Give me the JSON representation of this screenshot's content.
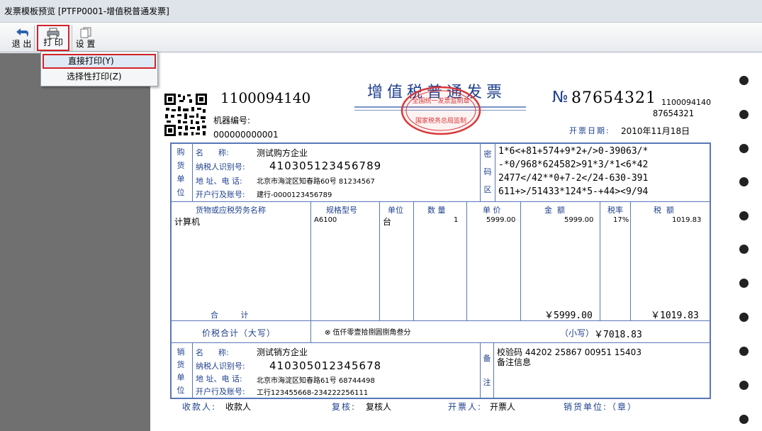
{
  "window": {
    "title": "发票模板预览 [PTFP0001-增值税普通发票]"
  },
  "toolbar": {
    "exit": "退 出",
    "print": "打 印",
    "settings": "设 置"
  },
  "menu": {
    "direct": "直接打印(Y)",
    "select": "选择性打印(Z)"
  },
  "invoice": {
    "title": "增值税普通发票",
    "code": "1100094140",
    "machine_label": "机器编号:",
    "machine_no": "000000000001",
    "no_prefix": "№",
    "number": "87654321",
    "code_small": "1100094140",
    "number_small": "87654321",
    "date_label": "开票日期:",
    "date": "2010年11月18日",
    "stamp_top": "全国统一发票监制章",
    "stamp_bottom": "国家税务总局监制",
    "buyer": {
      "side": [
        "购",
        "货",
        "单",
        "位"
      ],
      "name_label": "名      称:",
      "name": "测试购方企业",
      "tax_label": "纳税人识别号:",
      "tax": "410305123456789",
      "addr_label": "地 址、电 话:",
      "addr": "北京市海淀区知春路60号 81234567",
      "bank_label": "开户行及账号:",
      "bank": "建行-0000123456789"
    },
    "cipher": {
      "side": [
        "密",
        "码",
        "区"
      ],
      "lines": [
        "1*6<+81+574+9*2+/>0-39063/*",
        "-*0/968*624582>91*3/*1<6*42",
        "2477</42**0+7-2</24-630-391",
        "611+>/51433*124*5-+44><9/94"
      ]
    },
    "headers": {
      "item": "货物或应税劳务名称",
      "spec": "规格型号",
      "unit": "单位",
      "qty": "数 量",
      "price": "单 价",
      "amount": "金  额",
      "rate": "税率",
      "tax": "税  额"
    },
    "items": [
      {
        "name": "计算机",
        "spec": "A6100",
        "unit": "台",
        "qty": "1",
        "price": "5999.00",
        "amount": "5999.00",
        "rate": "17%",
        "tax": "1019.83"
      }
    ],
    "total_label": "合         计",
    "total_amount": "￥5999.00",
    "total_tax": "￥1019.83",
    "price_tax_label": "价税合计（大写）",
    "price_tax_upper": "⊗ 伍仟零壹拾捌圆捌角叁分",
    "small_label": "（小写）",
    "small_value": "￥7018.83",
    "seller": {
      "side": [
        "销",
        "货",
        "单",
        "位"
      ],
      "name_label": "名      称:",
      "name": "测试销方企业",
      "tax_label": "纳税人识别号:",
      "tax": "410305012345678",
      "addr_label": "地 址、电 话:",
      "addr": "北京市海淀区知春路61号 68744498",
      "bank_label": "开户行及账号:",
      "bank": "工行123455668-234222256111"
    },
    "remark": {
      "side": [
        "备",
        "注"
      ],
      "line1": "校验码 44202 25867 00951 15403",
      "line2": "备注信息"
    },
    "footer": {
      "payee_label": "收款人:",
      "payee": "收款人",
      "check_label": "复核:",
      "check": "复核人",
      "drawer_label": "开票人:",
      "drawer": "开票人",
      "seller_label": "销货单位:（章）"
    }
  }
}
